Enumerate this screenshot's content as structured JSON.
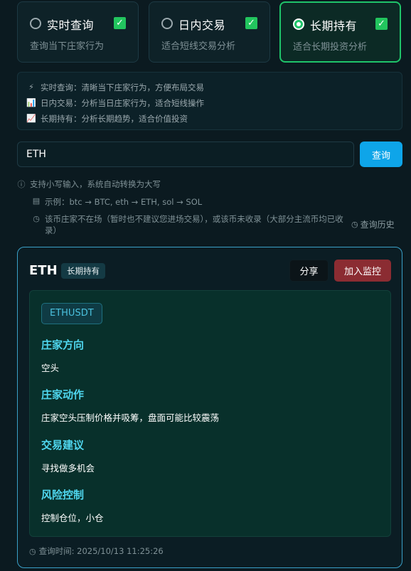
{
  "modes": [
    {
      "title": "实时查询",
      "subtitle": "查询当下庄家行为",
      "active": false
    },
    {
      "title": "日内交易",
      "subtitle": "适合短线交易分析",
      "active": false
    },
    {
      "title": "长期持有",
      "subtitle": "适合长期投资分析",
      "active": true
    }
  ],
  "mode_descriptions": [
    {
      "icon": "⚡",
      "text": "实时查询：清晰当下庄家行为，方便布局交易"
    },
    {
      "icon": "📊",
      "text": "日内交易：分析当日庄家行为，适合短线操作"
    },
    {
      "icon": "📈",
      "text": "长期持有：分析长期趋势，适合价值投资"
    }
  ],
  "search": {
    "value": "ETH",
    "button_label": "查询"
  },
  "hints": {
    "lowercase": "支持小写输入，系统自动转换为大写",
    "example": "示例：btc → BTC, eth → ETH, sol → SOL",
    "not_listed": "该币庄家不在场（暂时也不建议您进场交易），或该币未收录（大部分主流币均已收录）",
    "history_link": "查询历史"
  },
  "result": {
    "symbol": "ETH",
    "mode_badge": "长期持有",
    "share_label": "分享",
    "monitor_label": "加入监控",
    "pair": "ETHUSDT",
    "sections": [
      {
        "title": "庄家方向",
        "body": "空头"
      },
      {
        "title": "庄家动作",
        "body": "庄家空头压制价格并吸筹，盘面可能比较震荡"
      },
      {
        "title": "交易建议",
        "body": "寻找做多机会"
      },
      {
        "title": "风险控制",
        "body": "控制仓位，小仓"
      }
    ],
    "query_time": "查询时间: 2025/10/13 11:25:26"
  },
  "colors": {
    "accent_green": "#22c55e",
    "accent_blue": "#0ea5e9",
    "monitor_red": "#8b2c32",
    "section_title": "#4fd6ee"
  }
}
